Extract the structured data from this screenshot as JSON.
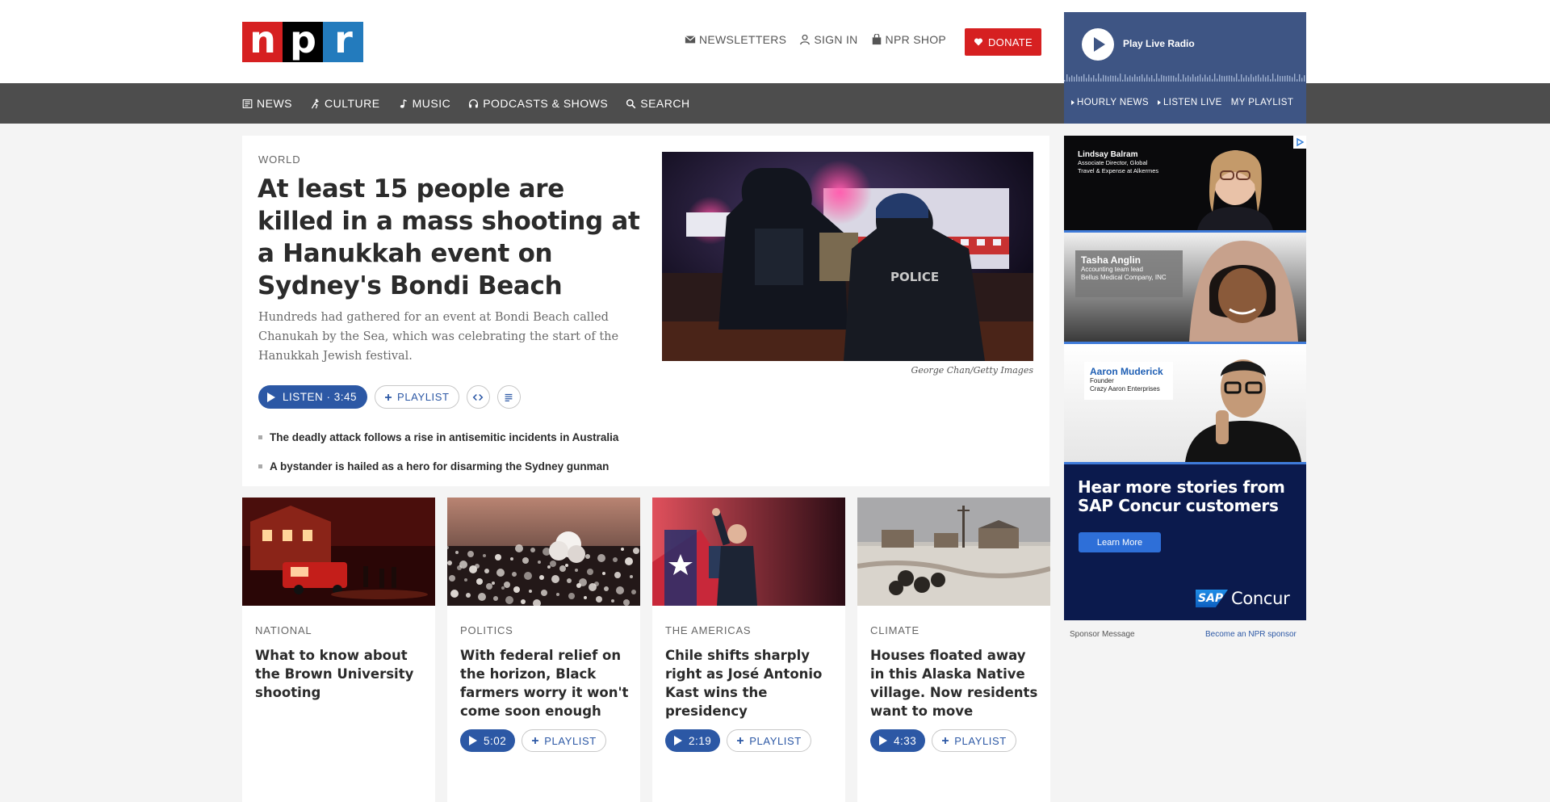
{
  "brand": {
    "logo_letters": [
      "n",
      "p",
      "r"
    ],
    "red": "#d62021",
    "blue": "#237bbd",
    "nav_bg": "#4d4d4d",
    "accent": "#2c58a5"
  },
  "utility": {
    "newsletters": "NEWSLETTERS",
    "sign_in": "SIGN IN",
    "shop": "NPR SHOP",
    "donate": "DONATE"
  },
  "nav": [
    "NEWS",
    "CULTURE",
    "MUSIC",
    "PODCASTS & SHOWS",
    "SEARCH"
  ],
  "radio": {
    "play_label": "Play Live Radio",
    "links": [
      "HOURLY NEWS",
      "LISTEN LIVE",
      "MY PLAYLIST"
    ]
  },
  "hero": {
    "slug": "WORLD",
    "title": "At least 15 people are killed in a mass shooting at a Hanukkah event on Sydney's Bondi Beach",
    "teaser": "Hundreds had gathered for an event at Bondi Beach called Chanukah by the Sea, which was celebrating the start of the Hanukkah Jewish festival.",
    "listen": "LISTEN · 3:45",
    "playlist": "PLAYLIST",
    "credit": "George Chan/Getty Images",
    "related": [
      "The deadly attack follows a rise in antisemitic incidents in Australia",
      "A bystander is hailed as a hero for disarming the Sydney gunman"
    ]
  },
  "cards": [
    {
      "slug": "NATIONAL",
      "title": "What to know about the Brown University shooting"
    },
    {
      "slug": "POLITICS",
      "title": "With federal relief on the horizon, Black farmers worry it won't come soon enough",
      "listen": "5:02",
      "playlist": "PLAYLIST"
    },
    {
      "slug": "THE AMERICAS",
      "title": "Chile shifts sharply right as José Antonio Kast wins the presidency",
      "listen": "2:19",
      "playlist": "PLAYLIST"
    },
    {
      "slug": "CLIMATE",
      "title": "Houses floated away in this Alaska Native village. Now residents want to move",
      "listen": "4:33",
      "playlist": "PLAYLIST"
    }
  ],
  "ad": {
    "people": [
      {
        "name": "Lindsay Balram",
        "role1": "Associate Director, Global",
        "role2": "Travel & Expense at Alkermes"
      },
      {
        "name": "Tasha Anglin",
        "role1": "Accounting team lead",
        "role2": "Bellus Medical Company, INC"
      },
      {
        "name": "Aaron Muderick",
        "role1": "Founder",
        "role2": "Crazy Aaron Enterprises"
      }
    ],
    "headline": "Hear more stories from SAP Concur customers",
    "cta": "Learn More",
    "logo_sap": "SAP",
    "logo_concur": "Concur"
  },
  "sponsor": {
    "message": "Sponsor Message",
    "become": "Become an NPR sponsor"
  }
}
